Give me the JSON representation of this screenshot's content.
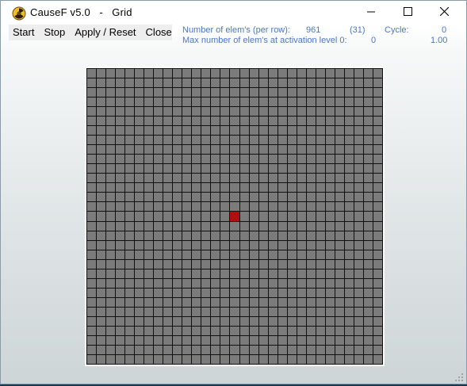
{
  "window": {
    "title": "CauseF v5.0   -   Grid",
    "app_icon": "radiation-trefoil-icon",
    "controls": [
      "minimize-icon",
      "maximize-icon",
      "close-icon"
    ]
  },
  "menu": {
    "items": [
      "Start",
      "Stop",
      "Apply / Reset",
      "Close"
    ]
  },
  "stats": {
    "elems_label": "Number of elem's (per row):",
    "elems_value": "961",
    "per_row_value": "(31)",
    "cycle_label": "Cycle:",
    "cycle_value": "0",
    "max_label": "Max number of elem's at activation level 0:",
    "max_value": "0",
    "ratio_value": "1.00"
  },
  "grid": {
    "rows": 31,
    "cols": 31,
    "active_cells": [
      {
        "row": 15,
        "col": 15
      }
    ],
    "cell_color": "#7b7b7b",
    "active_color": "#b30d0d",
    "line_color": "#111111"
  },
  "colors": {
    "info_text": "#4c75c8",
    "desktop": "#163a55"
  }
}
